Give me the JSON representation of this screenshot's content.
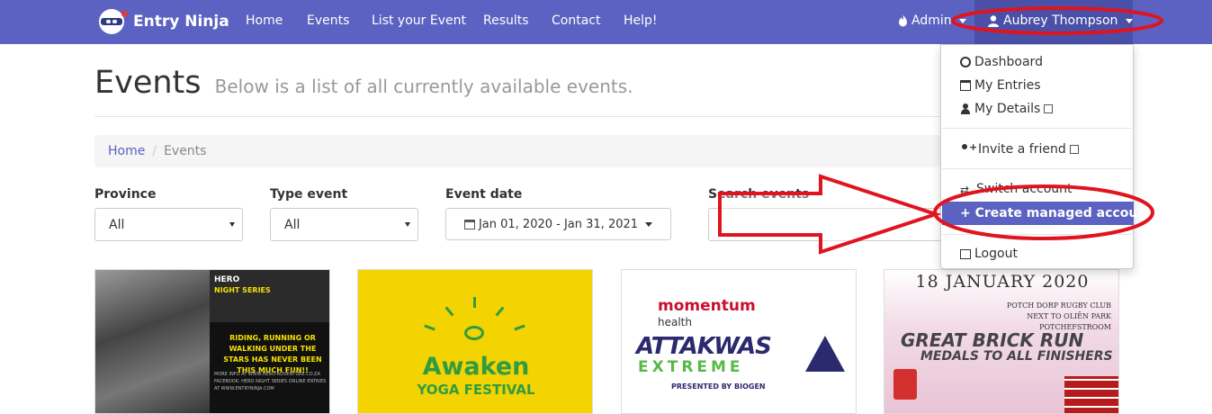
{
  "navbar": {
    "brand": "Entry Ninja",
    "links": [
      "Home",
      "Events",
      "List your Event",
      "Results",
      "Contact",
      "Help!"
    ],
    "admin_label": "Admin",
    "user_label": "Aubrey Thompson"
  },
  "page": {
    "title": "Events",
    "subtitle": "Below is a list of all currently available events."
  },
  "breadcrumb": {
    "home": "Home",
    "separator": "/",
    "current": "Events"
  },
  "filters": {
    "province_label": "Province",
    "province_value": "All",
    "type_label": "Type event",
    "type_value": "All",
    "date_label": "Event date",
    "date_value": "Jan 01, 2020 - Jan 31, 2021",
    "search_label": "Search events"
  },
  "cards": {
    "hero": {
      "title": "HERO",
      "subtitle": "NIGHT SERIES",
      "message": "RIDING, RUNNING OR WALKING UNDER THE STARS HAS NEVER BEEN THIS MUCH FUN!!",
      "small": "MORE INFO AT WWW.HERO-ADVENTURE.CO.ZA FACEBOOK: HERO NIGHT SERIES ONLINE ENTRIES AT WWW.ENTRYNINJA.COM"
    },
    "awaken": {
      "title": "Awaken",
      "subtitle": "YOGA FESTIVAL"
    },
    "attakwas": {
      "sponsor": "momentum",
      "sponsor_sub": "health",
      "title": "ATTAKWAS",
      "subtitle": "EXTREME",
      "presented": "PRESENTED BY BIOGEN"
    },
    "brick": {
      "date": "18 JANUARY 2020",
      "location": "POTCH DORP RUGBY CLUB\nNEXT TO OLIËN PARK\nPOTCHEFSTROOM",
      "title": "GREAT BRICK RUN",
      "subtitle": "MEDALS TO ALL FINISHERS"
    }
  },
  "user_menu": {
    "items": [
      "Dashboard",
      "My Entries",
      "My Details"
    ],
    "invite": "Invite a friend",
    "switch": "Switch account",
    "create": "Create managed account",
    "logout": "Logout"
  },
  "colors": {
    "navbar": "#5b62c1",
    "annotation": "#e0141e"
  }
}
